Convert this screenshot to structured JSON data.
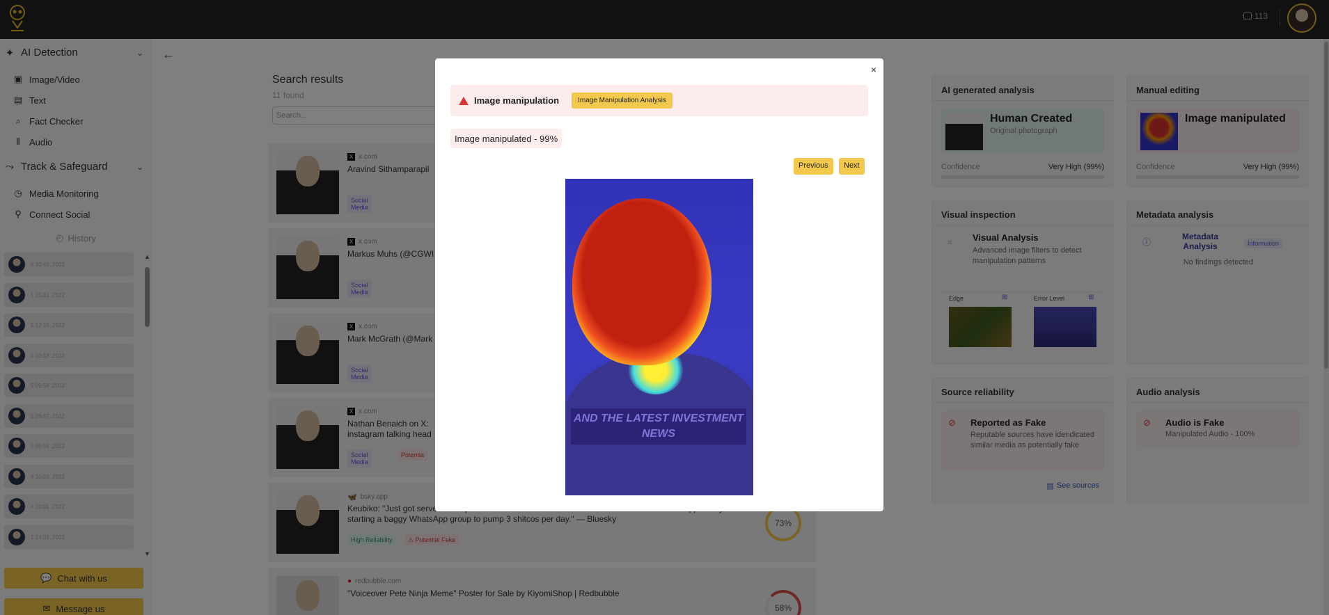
{
  "topbar": {
    "credits": "113"
  },
  "sidebar": {
    "sections": [
      {
        "label": "AI Detection",
        "items": [
          "Image/Video",
          "Text",
          "Fact Checker",
          "Audio"
        ]
      },
      {
        "label": "Track & Safeguard",
        "items": [
          "Media Monitoring",
          "Connect Social"
        ]
      }
    ],
    "history_label": "History",
    "history": [
      "6 10:49 ,2022",
      "5 15:31 ,2022",
      "5 12:15 ,2022",
      "5 10:18 ,2022",
      "5 09:58 ,2022",
      "5 09:57 ,2022",
      "5 09:56 ,2022",
      "4 10:03 ,2022",
      "4 10:01 ,2022",
      "1 14:01 ,2022"
    ],
    "chat_button": "Chat with us",
    "message_button": "Message us"
  },
  "search": {
    "title": "Search results",
    "count": "11 found",
    "placeholder": "Search..."
  },
  "results": [
    {
      "source": "x.com",
      "title": "Aravind Sithamparapil",
      "tags": [
        "Social Media"
      ]
    },
    {
      "source": "x.com",
      "title": "Markus Muhs (@CGWI",
      "tags": [
        "Social Media"
      ]
    },
    {
      "source": "x.com",
      "title": "Mark McGrath (@Mark",
      "tags": [
        "Social Media"
      ]
    },
    {
      "source": "x.com",
      "title": "Nathan Benaich on X:",
      "title2": "instagram talking head",
      "tags": [
        "Social Media",
        "Potentia"
      ]
    },
    {
      "source": "bsky.app",
      "title": "Keubiko: \"Just got served a deep fake video ad on Facebook - David Kostin from Goldman apparently",
      "title2": "starting a baggy WhatsApp group to pump 3 shitcos per day.\" — Bluesky",
      "tags": [
        "High Reliability",
        "Potential Fake"
      ],
      "score": "73%"
    },
    {
      "source": "redbubble.com",
      "title": "\"Voiceover Pete Ninja Meme\" Poster for Sale by KiyomiShop | Redbubble",
      "score": "58%"
    }
  ],
  "panels": {
    "ai_generated": {
      "title": "AI generated analysis",
      "result": "Human Created",
      "sub": "Original photograph",
      "confidence_label": "Confidence",
      "confidence_value": "Very High (99%)"
    },
    "manual_editing": {
      "title": "Manual editing",
      "result": "Image manipulated",
      "confidence_label": "Confidence",
      "confidence_value": "Very High (99%)"
    },
    "visual": {
      "title": "Visual inspection",
      "heading": "Visual Analysis",
      "desc": "Advanced image filters to detect manipulation patterns",
      "edge": "Edge",
      "error_level": "Error Level"
    },
    "metadata": {
      "title": "Metadata analysis",
      "heading": "Metadata Analysis",
      "badge": "Information",
      "desc": "No findings detected"
    },
    "source": {
      "title": "Source reliability",
      "heading": "Reported as Fake",
      "desc": "Reputable sources have idendicated similar media as potentially fake",
      "link": "See sources"
    },
    "audio": {
      "title": "Audio analysis",
      "heading": "Audio is Fake",
      "desc": "Manipulated Audio - 100%"
    }
  },
  "modal": {
    "close": "×",
    "alert_title": "Image manipulation",
    "alert_button": "Image Manipulation Analysis",
    "result_pill": "Image manipulated - 99%",
    "previous": "Previous",
    "next": "Next",
    "image_caption": "AND THE LATEST INVESTMENT NEWS"
  }
}
